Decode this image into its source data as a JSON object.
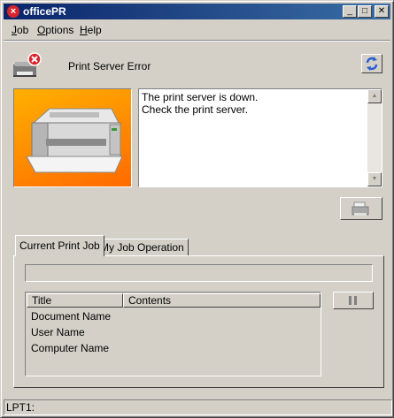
{
  "window": {
    "title": "officePR",
    "buttons": {
      "minimize": "_",
      "maximize": "□",
      "close": "✕"
    }
  },
  "menu": {
    "items": [
      {
        "hotkey": "J",
        "rest": "ob"
      },
      {
        "hotkey": "O",
        "rest": "ptions"
      },
      {
        "hotkey": "H",
        "rest": "elp"
      }
    ]
  },
  "header": {
    "title": "Print Server Error",
    "status_icon": "printer-error-icon",
    "refresh_icon": "refresh-icon"
  },
  "message": {
    "lines": [
      "The print server is down.",
      "Check the print server."
    ]
  },
  "tabs": [
    {
      "label": "Current Print Job",
      "selected": true
    },
    {
      "label": "My Job Operation",
      "selected": false
    }
  ],
  "job_list": {
    "columns": [
      "Title",
      "Contents"
    ],
    "rows": [
      "Document Name",
      "User Name",
      "Computer Name"
    ]
  },
  "status_bar": {
    "port": "LPT1:"
  },
  "colors": {
    "titlebar_start": "#0a246a",
    "titlebar_end": "#3a6ea5",
    "face": "#d4d0c8",
    "picture_bg": "#ff8a00",
    "error_red": "#d8252d"
  }
}
